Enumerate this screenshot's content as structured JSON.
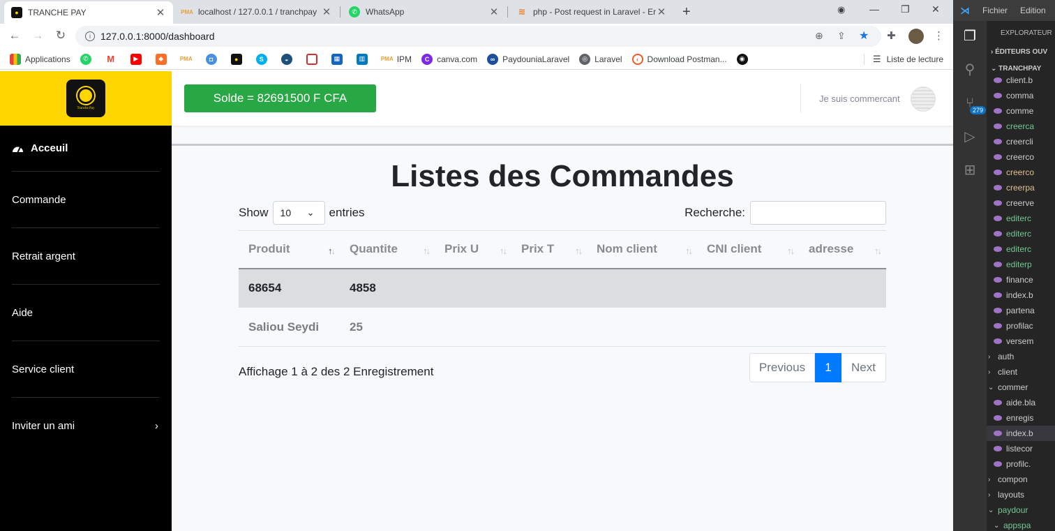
{
  "browser": {
    "tabs": [
      {
        "title": "TRANCHE PAY",
        "active": true
      },
      {
        "title": "localhost / 127.0.0.1 / tranchpay",
        "active": false
      },
      {
        "title": "WhatsApp",
        "active": false
      },
      {
        "title": "php - Post request in Laravel - Er",
        "active": false
      }
    ],
    "url": "127.0.0.1:8000/dashboard",
    "bookmarks": [
      "Applications",
      "IPM",
      "canva.com",
      "PaydouniaLaravel",
      "Laravel",
      "Download Postman..."
    ],
    "reading_list": "Liste de lecture"
  },
  "sidebar": {
    "items": [
      {
        "label": "Acceuil"
      },
      {
        "label": "Commande"
      },
      {
        "label": "Retrait argent"
      },
      {
        "label": "Aide"
      },
      {
        "label": "Service client"
      },
      {
        "label": "Inviter un ami"
      }
    ]
  },
  "topbar": {
    "solde": "Solde = 82691500 F CFA",
    "user_label": "Je suis commercant"
  },
  "main": {
    "title": "Listes des Commandes",
    "show_label": "Show",
    "entries_value": "10",
    "entries_label": "entries",
    "search_label": "Recherche:",
    "columns": [
      "Produit",
      "Quantite",
      "Prix U",
      "Prix T",
      "Nom client",
      "CNI client",
      "adresse"
    ],
    "rows": [
      [
        "68654",
        "4858",
        "",
        "",
        "",
        "",
        ""
      ],
      [
        "Saliou Seydi",
        "25",
        "",
        "",
        "",
        "",
        ""
      ]
    ],
    "info": "Affichage 1 à 2 des 2 Enregistrement",
    "pagination": {
      "previous": "Previous",
      "current": "1",
      "next": "Next"
    }
  },
  "vscode": {
    "menu": [
      "Fichier",
      "Edition"
    ],
    "explorer_title": "EXPLORATEUR",
    "open_editors": "ÉDITEURS OUV",
    "project": "TRANCHPAY",
    "badge": "279",
    "files": [
      "client.b",
      "comma",
      "comme",
      "creerca",
      "creercli",
      "creerco",
      "creerco",
      "creerpa",
      "creerve",
      "editerc",
      "editerc",
      "editerc",
      "editerp",
      "finance",
      "index.b",
      "partena",
      "profilac",
      "versem"
    ],
    "folders_a": [
      "auth",
      "client",
      "commer"
    ],
    "files_b": [
      "aide.bla",
      "enregis",
      "index.b",
      "listecor",
      "profilc."
    ],
    "folders_b": [
      "compon",
      "layouts",
      "paydour"
    ],
    "last": "appspa"
  }
}
